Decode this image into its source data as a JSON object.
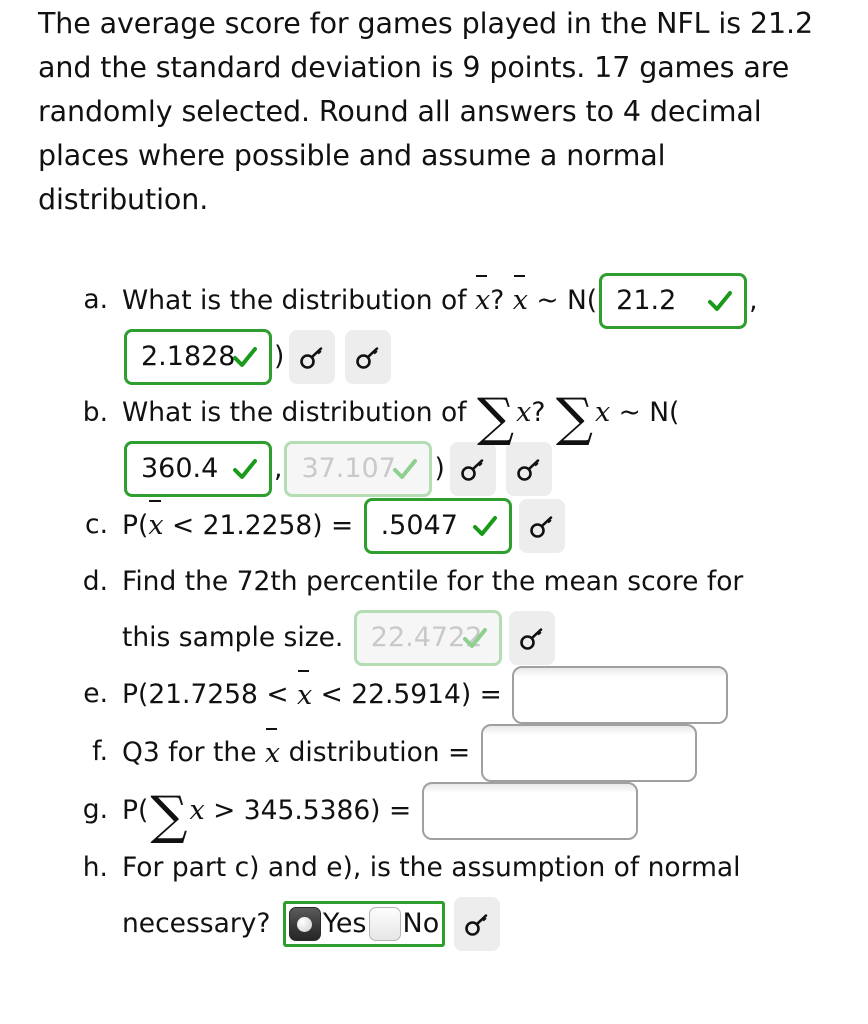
{
  "problem": {
    "statement": "The average score for games played in the NFL is 21.2 and the standard deviation is 9 points. 17 games are randomly selected. Round all answers to 4 decimal places where possible and assume a normal distribution."
  },
  "icons": {
    "key": "key-icon",
    "check": "checkmark-icon"
  },
  "colors": {
    "correct_border": "#2e9e2e",
    "correct_check": "#1a9a1a",
    "faded_border": "#b4ddb4",
    "faded_text": "#c9c9c9",
    "faded_check": "#8fcf8f",
    "empty_border": "#a0a0a0",
    "key_button_bg": "#ededed",
    "text": "#111111",
    "page_bg": "#ffffff"
  },
  "parts": [
    {
      "marker": "a.",
      "prompt_1": "What is the distribution of ",
      "prompt_2": "? ",
      "prompt_3": " ~ N(",
      "close_paren": ")",
      "comma": ",",
      "mean": {
        "value": "21.2",
        "state": "correct"
      },
      "sd": {
        "value": "2.1828",
        "state": "correct"
      }
    },
    {
      "marker": "b.",
      "prompt_1": "What is the distribution of ",
      "prompt_2": "? ",
      "prompt_3": " ~ N(",
      "close_paren": ")",
      "comma": ",",
      "mean": {
        "value": "360.4",
        "state": "correct"
      },
      "sd": {
        "value": "37.107",
        "state": "faded"
      }
    },
    {
      "marker": "c.",
      "prompt_1": "P(",
      "prompt_2": " < 21.2258) = ",
      "answer": {
        "value": ".5047",
        "state": "correct"
      }
    },
    {
      "marker": "d.",
      "prompt_line1": "Find the 72th percentile for the mean score for",
      "prompt_line2": "this sample size. ",
      "answer": {
        "value": "22.4722",
        "state": "faded"
      }
    },
    {
      "marker": "e.",
      "prompt_1": "P(21.7258 < ",
      "prompt_2": " < 22.5914) = ",
      "answer": {
        "value": "",
        "state": "empty"
      }
    },
    {
      "marker": "f.",
      "prompt_1": "Q3 for the ",
      "prompt_2": " distribution = ",
      "answer": {
        "value": "",
        "state": "empty"
      }
    },
    {
      "marker": "g.",
      "prompt_1": "P(",
      "prompt_2": " > 345.5386) = ",
      "answer": {
        "value": "",
        "state": "empty"
      }
    },
    {
      "marker": "h.",
      "prompt_line1": "For part c) and e), is the assumption of normal",
      "prompt_line2": "necessary? ",
      "options": [
        {
          "label": "Yes",
          "selected": true
        },
        {
          "label": "No",
          "selected": false
        }
      ]
    }
  ]
}
